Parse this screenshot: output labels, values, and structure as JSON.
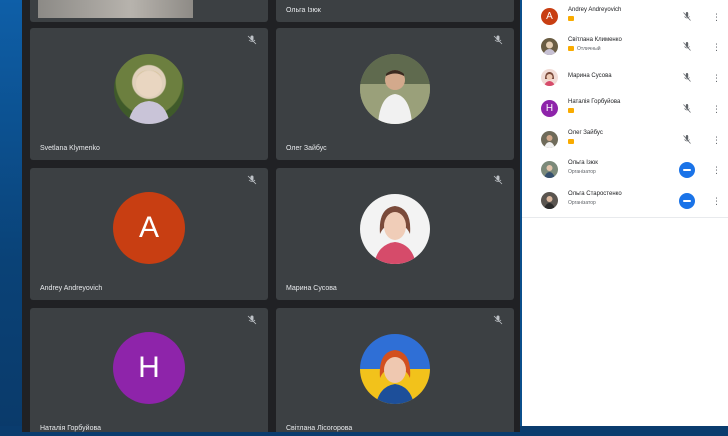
{
  "tiles": [
    {
      "name": "",
      "type": "partial"
    },
    {
      "name": "Ольга Ізюк",
      "type": "partial"
    },
    {
      "name": "Svetlana Klymenko",
      "type": "photo"
    },
    {
      "name": "Олег Зайбус",
      "type": "photo"
    },
    {
      "name": "Andrey Andreyovich",
      "type": "letter",
      "letter": "A",
      "color": "#c83e12"
    },
    {
      "name": "Марина Сусова",
      "type": "photo"
    },
    {
      "name": "Наталія Горбуйова",
      "type": "letter",
      "letter": "H",
      "color": "#8e24aa"
    },
    {
      "name": "Світлана Лісогорова",
      "type": "photo"
    }
  ],
  "participants": [
    {
      "name": "Andrey Andreyovich",
      "sub": "",
      "avatar_letter": "A",
      "avatar_color": "#c83e12",
      "action": "mute"
    },
    {
      "name": "Світлана Клименко",
      "sub": "Отличный",
      "avatar_letter": "",
      "avatar_color": "#6a5d43",
      "action": "mute"
    },
    {
      "name": "Марина Сусова",
      "sub": "",
      "avatar_letter": "",
      "avatar_color": "#d9a6a0",
      "action": "mute"
    },
    {
      "name": "Наталія Горбуйова",
      "sub": "",
      "avatar_letter": "H",
      "avatar_color": "#8e24aa",
      "action": "mute"
    },
    {
      "name": "Олег Зайбус",
      "sub": "",
      "avatar_letter": "",
      "avatar_color": "#6f6b5a",
      "action": "mute"
    },
    {
      "name": "Ольга Ізюк",
      "sub": "Організатор",
      "avatar_letter": "",
      "avatar_color": "#7c8a7a",
      "action": "pin"
    },
    {
      "name": "Ольга Старостенко",
      "sub": "Організатор",
      "avatar_letter": "",
      "avatar_color": "#5a5550",
      "action": "pin"
    }
  ],
  "icons": {
    "mic_off": "mic-off-icon",
    "more": "more-vert-icon",
    "pin": "pin-icon"
  },
  "colors": {
    "tile_bg": "#3c4043",
    "panel_bg": "#202124",
    "accent": "#1a73e8"
  }
}
